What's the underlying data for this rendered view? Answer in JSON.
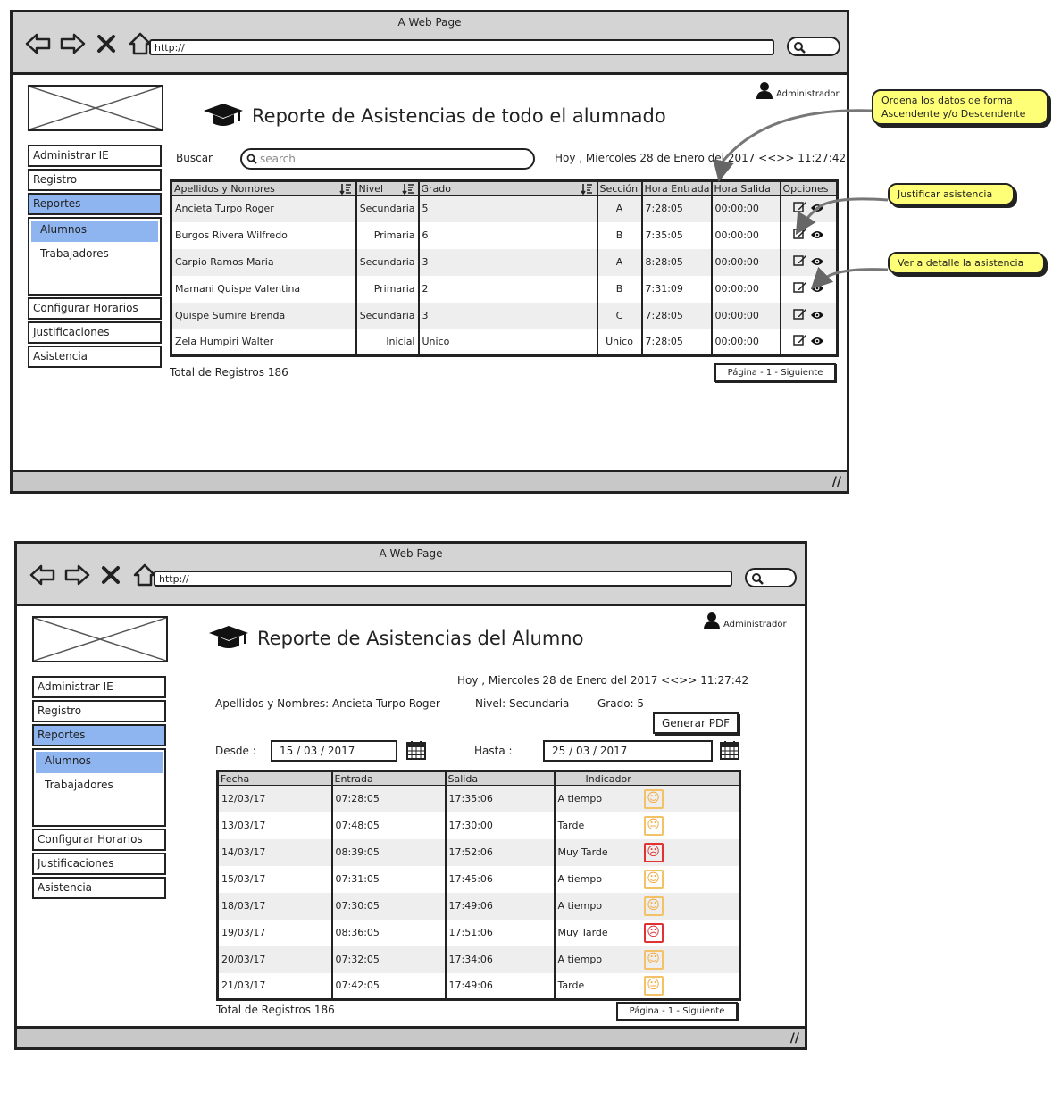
{
  "browser": {
    "title": "A Web Page",
    "url": "http://"
  },
  "screen1": {
    "user": "Administrador",
    "title": "Reporte de Asistencias de todo el alumnado",
    "menu": {
      "admin_ie": "Administrar IE",
      "registro": "Registro",
      "reportes": "Reportes",
      "alumnos": "Alumnos",
      "trabajadores": "Trabajadores",
      "config": "Configurar Horarios",
      "justif": "Justificaciones",
      "asistencia": "Asistencia"
    },
    "search_label": "Buscar",
    "search_placeholder": "search",
    "datetime": "Hoy , Miercoles 28 de Enero del 2017 <<>> 11:27:42",
    "columns": [
      "Apellidos y Nombres",
      "Nivel",
      "Grado",
      "Sección",
      "Hora Entrada",
      "Hora Salida",
      "Opciones"
    ],
    "rows": [
      [
        "Ancieta Turpo Roger",
        "Secundaria",
        "5",
        "A",
        "7:28:05",
        "00:00:00"
      ],
      [
        "Burgos Rivera Wilfredo",
        "Primaria",
        "6",
        "B",
        "7:35:05",
        "00:00:00"
      ],
      [
        "Carpio Ramos Maria",
        "Secundaria",
        "3",
        "A",
        "8:28:05",
        "00:00:00"
      ],
      [
        "Mamani Quispe Valentina",
        "Primaria",
        "2",
        "B",
        "7:31:09",
        "00:00:00"
      ],
      [
        "Quispe Sumire Brenda",
        "Secundaria",
        "3",
        "C",
        "7:28:05",
        "00:00:00"
      ],
      [
        "Zela Humpiri Walter",
        "Inicial",
        "Unico",
        "Unico",
        "7:28:05",
        "00:00:00"
      ]
    ],
    "total": "Total de Registros 186",
    "pager": "Página - 1 - Siguiente",
    "callouts": {
      "sort": "Ordena los datos de forma Ascendente y/o Descendente",
      "justify": "Justificar asistencia",
      "detail": "Ver a detalle la asistencia"
    }
  },
  "screen2": {
    "user": "Administrador",
    "title": "Reporte de Asistencias del Alumno",
    "datetime": "Hoy , Miercoles 28 de Enero del 2017 <<>> 11:27:42",
    "student": "Apellidos y Nombres: Ancieta Turpo Roger",
    "level": "Nivel: Secundaria",
    "grade": "Grado: 5",
    "pdf_button": "Generar PDF",
    "from_label": "Desde :",
    "from_value": "15 / 03 /  2017",
    "to_label": "Hasta :",
    "to_value": "25 / 03 / 2017",
    "columns": [
      "Fecha",
      "Entrada",
      "Salida",
      "Indicador"
    ],
    "rows": [
      [
        "12/03/17",
        "07:28:05",
        "17:35:06",
        "A tiempo",
        "ok"
      ],
      [
        "13/03/17",
        "07:48:05",
        "17:30:00",
        "Tarde",
        "late"
      ],
      [
        "14/03/17",
        "08:39:05",
        "17:52:06",
        "Muy Tarde",
        "bad"
      ],
      [
        "15/03/17",
        "07:31:05",
        "17:45:06",
        "A tiempo",
        "ok"
      ],
      [
        "18/03/17",
        "07:30:05",
        "17:49:06",
        "A tiempo",
        "ok"
      ],
      [
        "19/03/17",
        "08:36:05",
        "17:51:06",
        "Muy Tarde",
        "bad"
      ],
      [
        "20/03/17",
        "07:32:05",
        "17:34:06",
        "A tiempo",
        "ok"
      ],
      [
        "21/03/17",
        "07:42:05",
        "17:49:06",
        "Tarde",
        "late"
      ]
    ],
    "total": "Total de Registros 186",
    "pager": "Página - 1 - Siguiente"
  },
  "colors": {
    "active_menu": "#8eb5f0",
    "callout": "#ffff77",
    "face_ok": "#f4a83a",
    "face_bad": "#e03232"
  }
}
